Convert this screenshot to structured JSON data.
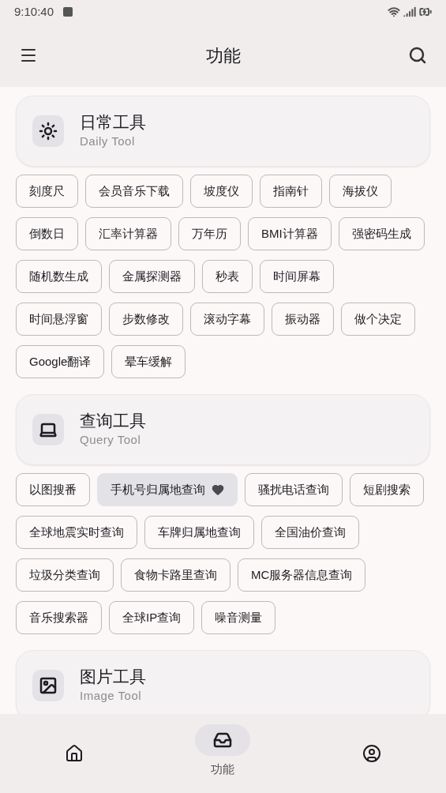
{
  "status_bar": {
    "time": "9:10:40"
  },
  "app_bar": {
    "title": "功能"
  },
  "sections": [
    {
      "kind": "sun",
      "title": "日常工具",
      "subtitle": "Daily Tool",
      "chips": [
        {
          "label": "刻度尺",
          "favorite": false
        },
        {
          "label": "会员音乐下载",
          "favorite": false
        },
        {
          "label": "坡度仪",
          "favorite": false
        },
        {
          "label": "指南针",
          "favorite": false
        },
        {
          "label": "海拔仪",
          "favorite": false
        },
        {
          "label": "倒数日",
          "favorite": false
        },
        {
          "label": "汇率计算器",
          "favorite": false
        },
        {
          "label": "万年历",
          "favorite": false
        },
        {
          "label": "BMI计算器",
          "favorite": false
        },
        {
          "label": "强密码生成",
          "favorite": false
        },
        {
          "label": "随机数生成",
          "favorite": false
        },
        {
          "label": "金属探测器",
          "favorite": false
        },
        {
          "label": "秒表",
          "favorite": false
        },
        {
          "label": "时间屏幕",
          "favorite": false
        },
        {
          "label": "时间悬浮窗",
          "favorite": false
        },
        {
          "label": "步数修改",
          "favorite": false
        },
        {
          "label": "滚动字幕",
          "favorite": false
        },
        {
          "label": "振动器",
          "favorite": false
        },
        {
          "label": "做个决定",
          "favorite": false
        },
        {
          "label": "Google翻译",
          "favorite": false
        },
        {
          "label": "晕车缓解",
          "favorite": false
        }
      ]
    },
    {
      "kind": "laptop",
      "title": "查询工具",
      "subtitle": "Query Tool",
      "chips": [
        {
          "label": "以图搜番",
          "favorite": false
        },
        {
          "label": "手机号归属地查询",
          "favorite": true
        },
        {
          "label": "骚扰电话查询",
          "favorite": false
        },
        {
          "label": "短剧搜索",
          "favorite": false
        },
        {
          "label": "全球地震实时查询",
          "favorite": false
        },
        {
          "label": "车牌归属地查询",
          "favorite": false
        },
        {
          "label": "全国油价查询",
          "favorite": false
        },
        {
          "label": "垃圾分类查询",
          "favorite": false
        },
        {
          "label": "食物卡路里查询",
          "favorite": false
        },
        {
          "label": "MC服务器信息查询",
          "favorite": false
        },
        {
          "label": "音乐搜索器",
          "favorite": false
        },
        {
          "label": "全球IP查询",
          "favorite": false
        },
        {
          "label": "噪音测量",
          "favorite": false
        }
      ]
    },
    {
      "kind": "image",
      "title": "图片工具",
      "subtitle": "Image Tool"
    }
  ],
  "bottom_nav": [
    {
      "kind": "home",
      "selected": false
    },
    {
      "kind": "tools",
      "label": "功能",
      "selected": true
    },
    {
      "kind": "account",
      "selected": false
    }
  ]
}
